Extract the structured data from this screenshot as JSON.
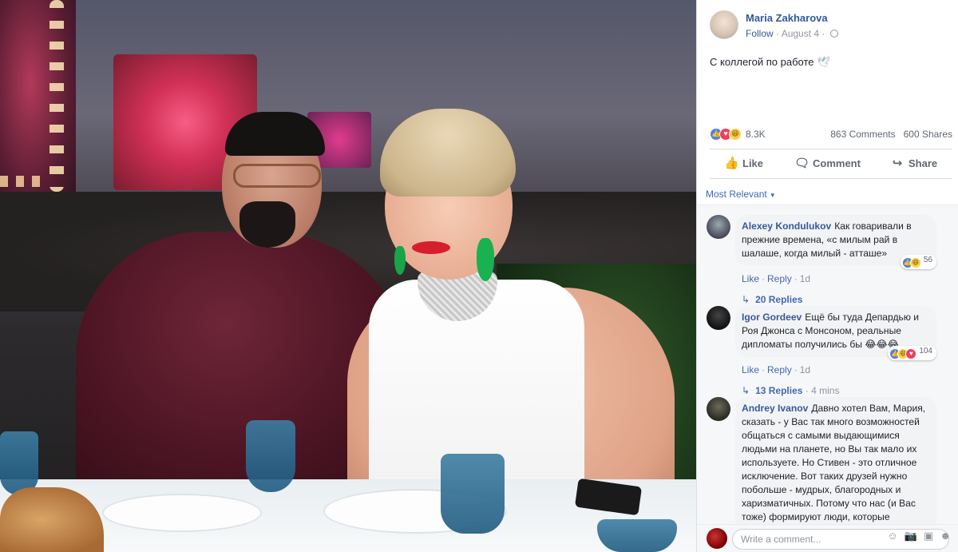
{
  "post": {
    "author": "Maria Zakharova",
    "follow_label": "Follow",
    "date": "August 4",
    "separator": "·",
    "text": "С коллегой по работе"
  },
  "stats": {
    "reactions_count": "8.3K",
    "comments_count": "863 Comments",
    "shares_count": "600 Shares"
  },
  "actions": {
    "like": "Like",
    "comment": "Comment",
    "share": "Share"
  },
  "sort_label": "Most Relevant",
  "comments": [
    {
      "author": "Alexey Kondulukov",
      "text": "Как говаривали в прежние времена, «с милым рай в шалаше, когда милый - атташе»",
      "like": "Like",
      "reply": "Reply",
      "time": "1d",
      "reaction_count": "56",
      "replies": "20 Replies",
      "replies_time": ""
    },
    {
      "author": "Igor Gordeev",
      "text": "Ещё бы туда Депардью и Роя Джонса с Монсоном, реальные дипломаты получились бы 😂😂😂",
      "like": "Like",
      "reply": "Reply",
      "time": "1d",
      "reaction_count": "104",
      "replies": "13 Replies",
      "replies_time": "4 mins"
    },
    {
      "author": "Andrey Ivanov",
      "text": "Давно хотел Вам, Мария, сказать - у Вас так много возможностей общаться с самыми выдающимися людьми на планете, но Вы так мало их используете. Но Стивен - это отличное исключение. Вот таких друзей нужно побольше - мудрых, благородных и харизматичных. Потому что нас (и Вас тоже) формируют люди, которые находятся в ближнем круге общения. От"
    }
  ],
  "composer": {
    "placeholder": "Write a comment..."
  },
  "icons": {
    "like": "thumbs-up-icon",
    "comment": "speech-bubble-icon",
    "share": "share-arrow-icon",
    "globe": "globe-icon"
  },
  "colors": {
    "link": "#365899",
    "accent": "#4267b2",
    "muted": "#90949c",
    "like_reaction": "#4a7cf6",
    "love_reaction": "#f33e58",
    "haha_reaction": "#fbcf4a"
  }
}
